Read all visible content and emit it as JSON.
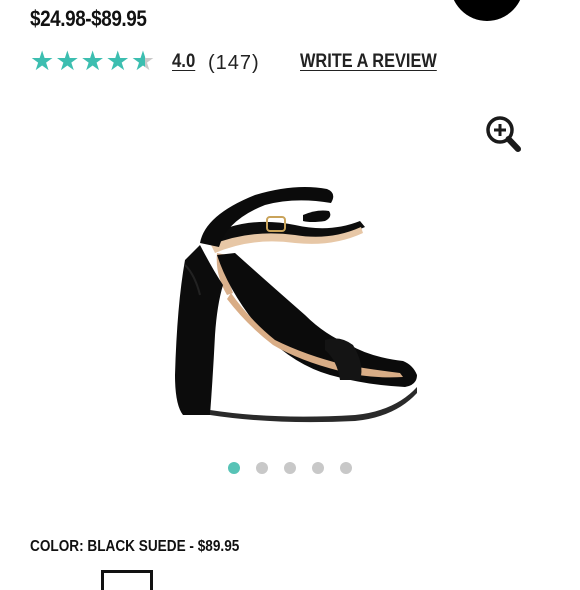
{
  "product": {
    "price_range": "$24.98-$89.95",
    "color_label": "COLOR: BLACK SUEDE - $89.95"
  },
  "rating": {
    "value": "4.0",
    "count": "(147)",
    "stars_filled": 4.5,
    "stars_total": 5,
    "star_color": "#3cbeb0",
    "star_empty_color": "#c9c9c9",
    "write_review_label": "WRITE A REVIEW"
  },
  "gallery": {
    "active_index": 0,
    "total": 5,
    "active_dot_color": "#57c3b6",
    "inactive_dot_color": "#c8c8c8",
    "zoom_icon": "zoom-in-icon",
    "image_subject": "black suede block-heel ankle-strap sandal"
  }
}
